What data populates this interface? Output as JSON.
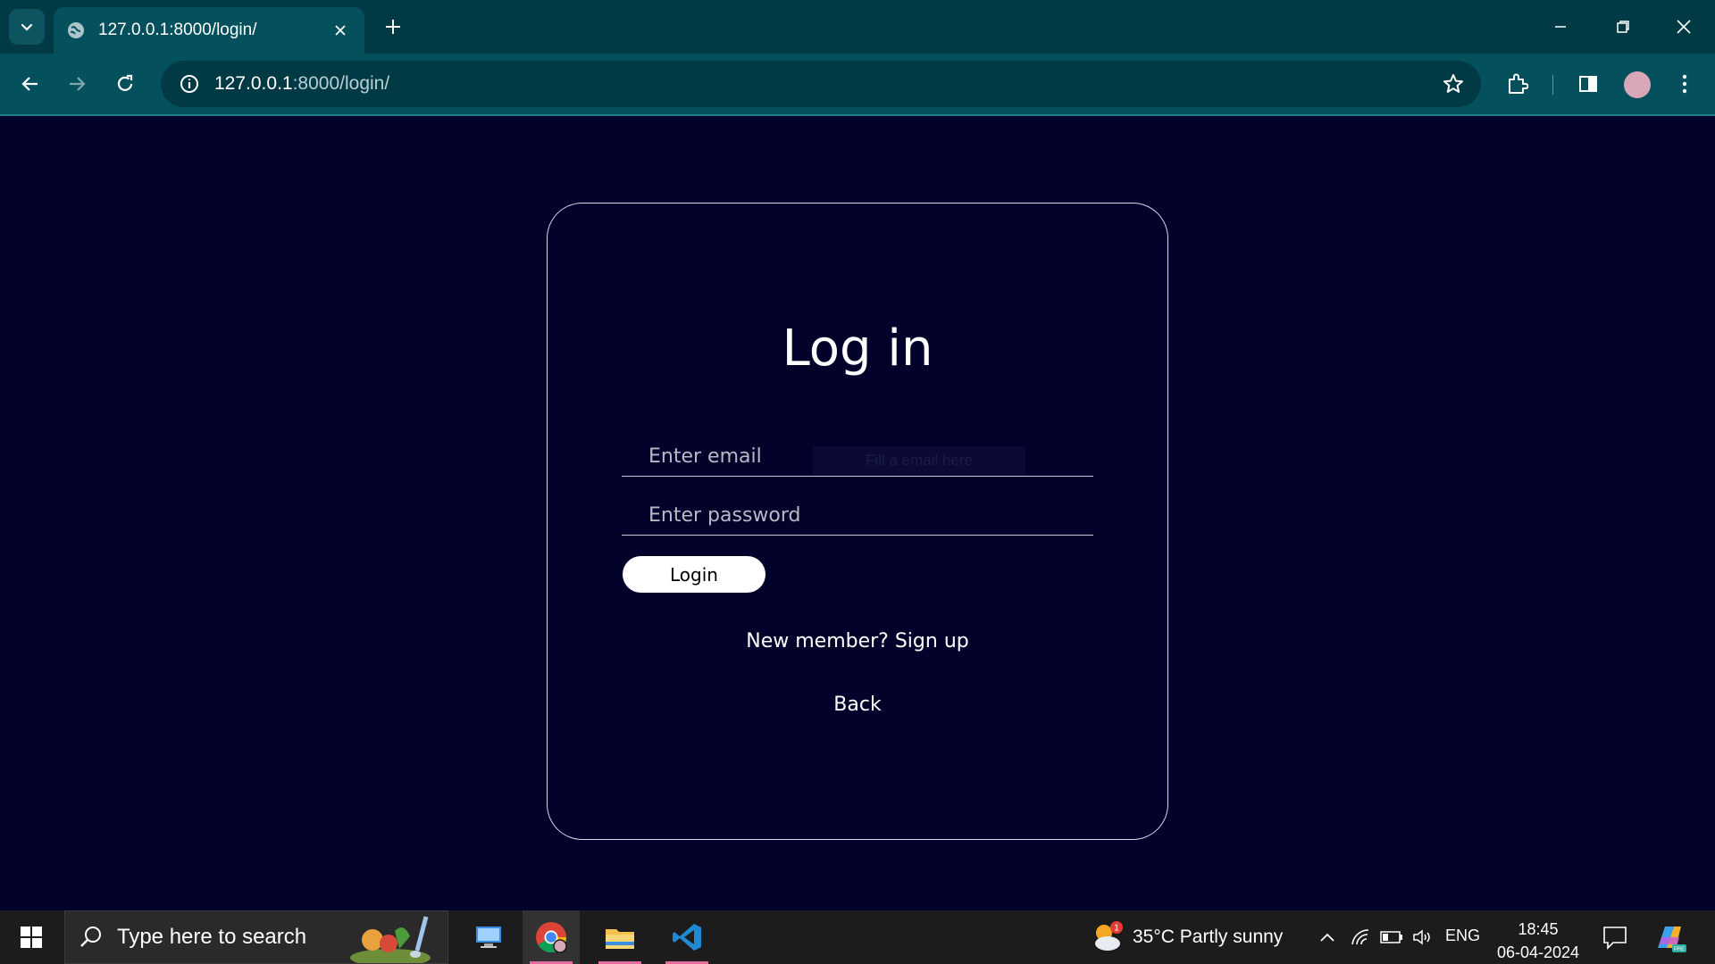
{
  "browser": {
    "tab_title": "127.0.0.1:8000/login/",
    "url_host": "127.0.0.1",
    "url_path": ":8000/login/"
  },
  "page": {
    "heading": "Log in",
    "email_placeholder": "Enter email",
    "password_placeholder": "Enter password",
    "tooltip_ghost": "Fill a email here",
    "login_label": "Login",
    "signup_link": "New member? Sign up",
    "back_link": "Back"
  },
  "taskbar": {
    "search_placeholder": "Type here to search",
    "weather": "35°C  Partly sunny",
    "weather_badge": "1",
    "language": "ENG",
    "time": "18:45",
    "date": "06-04-2024"
  },
  "colors": {
    "page_bg": "#03022a",
    "chrome_tabbar": "#013a45",
    "chrome_toolbar": "#04515d",
    "taskbar": "#1c1c1c",
    "accent_underline": "#e46c9c"
  },
  "icons": [
    "chevron-down-icon",
    "globe-icon",
    "close-icon",
    "plus-icon",
    "minimize-icon",
    "restore-icon",
    "back-arrow-icon",
    "forward-arrow-icon",
    "reload-icon",
    "info-icon",
    "star-icon",
    "extensions-icon",
    "side-panel-icon",
    "kebab-menu-icon",
    "windows-start-icon",
    "search-icon",
    "chrome-icon",
    "file-explorer-icon",
    "vscode-icon",
    "weather-icon",
    "chevron-up-icon",
    "wifi-icon",
    "battery-icon",
    "speaker-icon",
    "notification-icon",
    "copilot-icon"
  ]
}
